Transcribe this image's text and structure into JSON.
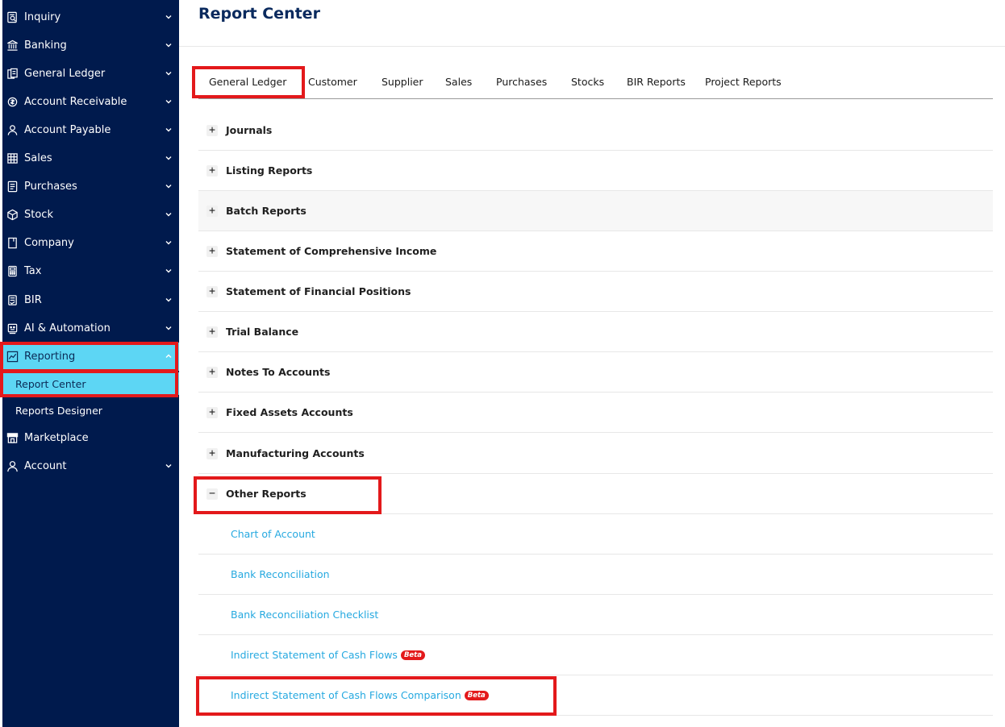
{
  "sidebar": {
    "items": [
      {
        "label": "Inquiry",
        "icon": "inquiry-icon"
      },
      {
        "label": "Banking",
        "icon": "bank-icon"
      },
      {
        "label": "General Ledger",
        "icon": "ledger-icon"
      },
      {
        "label": "Account Receivable",
        "icon": "receivable-icon"
      },
      {
        "label": "Account Payable",
        "icon": "payable-icon"
      },
      {
        "label": "Sales",
        "icon": "sales-icon"
      },
      {
        "label": "Purchases",
        "icon": "purchases-icon"
      },
      {
        "label": "Stock",
        "icon": "stock-icon"
      },
      {
        "label": "Company",
        "icon": "company-icon"
      },
      {
        "label": "Tax",
        "icon": "tax-icon"
      },
      {
        "label": "BIR",
        "icon": "bir-icon"
      },
      {
        "label": "AI & Automation",
        "icon": "ai-icon"
      },
      {
        "label": "Reporting",
        "icon": "chart-icon"
      },
      {
        "label": "Marketplace",
        "icon": "store-icon"
      },
      {
        "label": "Account",
        "icon": "user-icon"
      }
    ],
    "reporting_sub": [
      "Report Center",
      "Reports Designer"
    ]
  },
  "header": {
    "title": "Report Center"
  },
  "tabs": [
    "General Ledger",
    "Customer",
    "Supplier",
    "Sales",
    "Purchases",
    "Stocks",
    "BIR Reports",
    "Project Reports"
  ],
  "sections": [
    {
      "label": "Journals",
      "toggle": "+"
    },
    {
      "label": "Listing Reports",
      "toggle": "+"
    },
    {
      "label": "Batch Reports",
      "toggle": "+"
    },
    {
      "label": "Statement of Comprehensive Income",
      "toggle": "+"
    },
    {
      "label": "Statement of Financial Positions",
      "toggle": "+"
    },
    {
      "label": "Trial Balance",
      "toggle": "+"
    },
    {
      "label": "Notes To Accounts",
      "toggle": "+"
    },
    {
      "label": "Fixed Assets Accounts",
      "toggle": "+"
    },
    {
      "label": "Manufacturing Accounts",
      "toggle": "+"
    },
    {
      "label": "Other Reports",
      "toggle": "−"
    }
  ],
  "other_reports": [
    {
      "label": "Chart of Account",
      "badge": ""
    },
    {
      "label": "Bank Reconciliation",
      "badge": ""
    },
    {
      "label": "Bank Reconciliation Checklist",
      "badge": ""
    },
    {
      "label": "Indirect Statement of Cash Flows",
      "badge": "Beta"
    },
    {
      "label": "Indirect Statement of Cash Flows Comparison",
      "badge": "Beta"
    }
  ],
  "colors": {
    "sidebar_bg": "#001a4d",
    "active_bg": "#5dd6f4",
    "link": "#26a9e0",
    "highlight": "#e3191b",
    "title": "#0a2a5e"
  }
}
